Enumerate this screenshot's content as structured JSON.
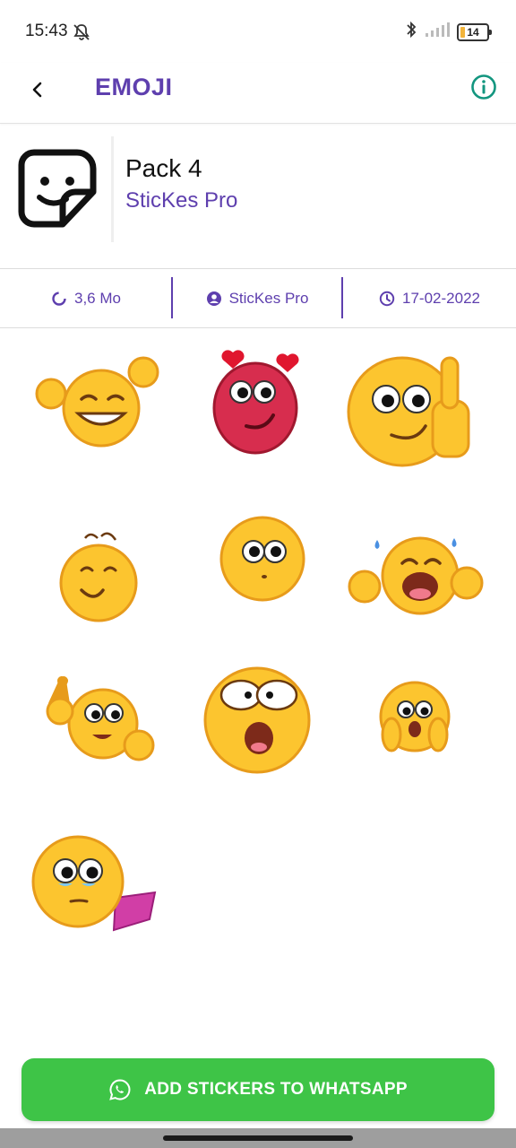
{
  "status_bar": {
    "time": "15:43",
    "battery": "14"
  },
  "app_bar": {
    "title": "EMOJI"
  },
  "pack": {
    "name": "Pack 4",
    "publisher": "SticKes Pro"
  },
  "info": {
    "size": "3,6 Mo",
    "author": "SticKes Pro",
    "date": "17-02-2022"
  },
  "stickers": [
    "waving-fists-emoji",
    "heart-eyes-red-emoji",
    "thumbs-up-emoji",
    "content-smile-emoji",
    "surprised-emoji",
    "crying-fists-emoji",
    "peace-sign-emoji",
    "shocked-emoji",
    "scared-hands-emoji",
    "teary-cape-emoji"
  ],
  "footer": {
    "add_button_label": "ADD STICKERS TO WHATSAPP"
  },
  "colors": {
    "accent": "#5e3fae",
    "whatsapp_green": "#3ec447",
    "info_teal": "#13967f"
  }
}
